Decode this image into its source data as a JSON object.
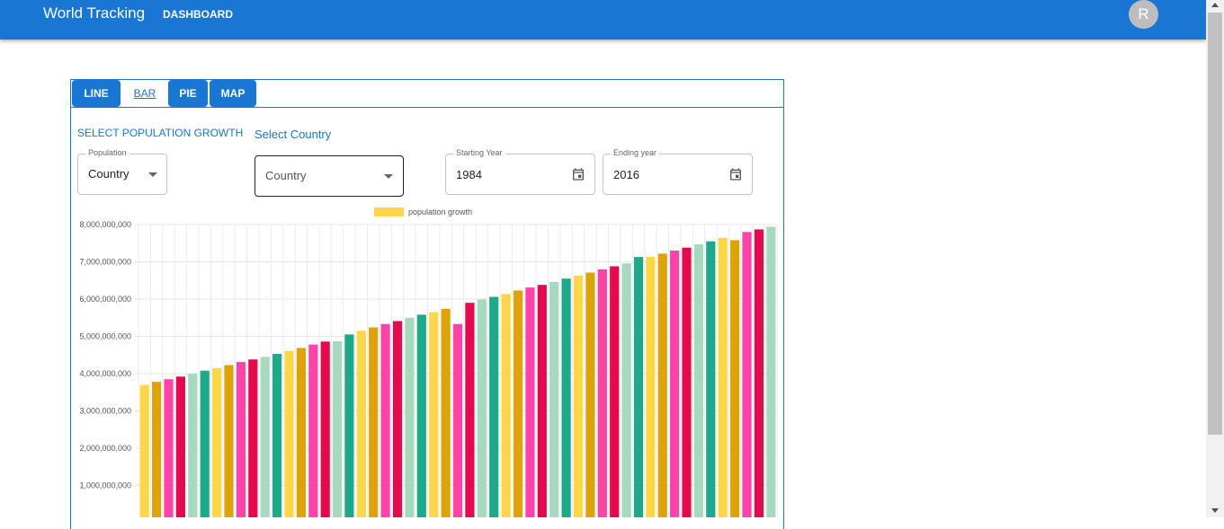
{
  "appbar": {
    "title": "World Tracking",
    "nav_dashboard": "DASHBOARD",
    "avatar_letter": "R",
    "color": "#1976d2"
  },
  "tabs": [
    {
      "label": "LINE",
      "style": "filled"
    },
    {
      "label": "BAR",
      "style": "text"
    },
    {
      "label": "PIE",
      "style": "filled"
    },
    {
      "label": "MAP",
      "style": "filled"
    }
  ],
  "controls": {
    "select_population_growth": "SELECT POPULATION GROWTH",
    "select_country": "Select Country",
    "population_select": {
      "label": "Population",
      "value": "Country"
    },
    "country_select": {
      "placeholder": "Country"
    },
    "starting_year": {
      "label": "Starting Year",
      "value": "1984"
    },
    "ending_year": {
      "label": "Ending year",
      "value": "2016"
    }
  },
  "chart_data": {
    "type": "bar",
    "legend": [
      "population growth"
    ],
    "legend_position": "top",
    "grid": true,
    "ylim": [
      0,
      8000000000
    ],
    "y_ticks": [
      "8,000,000,000",
      "7,000,000,000",
      "6,000,000,000",
      "5,000,000,000",
      "4,000,000,000",
      "3,000,000,000",
      "2,000,000,000",
      "1,000,000,000"
    ],
    "series": [
      {
        "name": "population growth",
        "values": [
          3700000000,
          3780000000,
          3850000000,
          3920000000,
          4000000000,
          4080000000,
          4150000000,
          4230000000,
          4310000000,
          4380000000,
          4450000000,
          4530000000,
          4610000000,
          4690000000,
          4780000000,
          4860000000,
          4870000000,
          5050000000,
          5150000000,
          5240000000,
          5330000000,
          5410000000,
          5500000000,
          5580000000,
          5650000000,
          5740000000,
          5330000000,
          5900000000,
          5990000000,
          6060000000,
          6140000000,
          6230000000,
          6310000000,
          6380000000,
          6460000000,
          6550000000,
          6630000000,
          6710000000,
          6800000000,
          6880000000,
          6960000000,
          7130000000,
          7130000000,
          7220000000,
          7300000000,
          7380000000,
          7470000000,
          7550000000,
          7640000000,
          7580000000,
          7800000000,
          7870000000,
          7940000000
        ],
        "colors": [
          "#fdd649",
          "#dca30a",
          "#fc44a8",
          "#e30a4e",
          "#a8d8bd",
          "#1ea98a",
          "#fdd649",
          "#dca30a",
          "#fc44a8",
          "#e30a4e",
          "#a8d8bd",
          "#1ea98a",
          "#fdd649",
          "#dca30a",
          "#fc44a8",
          "#e30a4e",
          "#a8d8bd",
          "#1ea98a",
          "#fdd649",
          "#dca30a",
          "#fc44a8",
          "#e30a4e",
          "#a8d8bd",
          "#1ea98a",
          "#fdd649",
          "#dca30a",
          "#fc44a8",
          "#e30a4e",
          "#a8d8bd",
          "#1ea98a",
          "#fdd649",
          "#dca30a",
          "#fc44a8",
          "#e30a4e",
          "#a8d8bd",
          "#1ea98a",
          "#fdd649",
          "#dca30a",
          "#fc44a8",
          "#e30a4e",
          "#a8d8bd",
          "#1ea98a",
          "#fdd649",
          "#dca30a",
          "#fc44a8",
          "#e30a4e",
          "#a8d8bd",
          "#1ea98a",
          "#fdd649",
          "#dca30a",
          "#fc44a8",
          "#e30a4e",
          "#a8d8bd"
        ]
      }
    ]
  },
  "icons": {
    "calendar": "calendar-icon",
    "dropdown": "chevron-down-icon"
  }
}
